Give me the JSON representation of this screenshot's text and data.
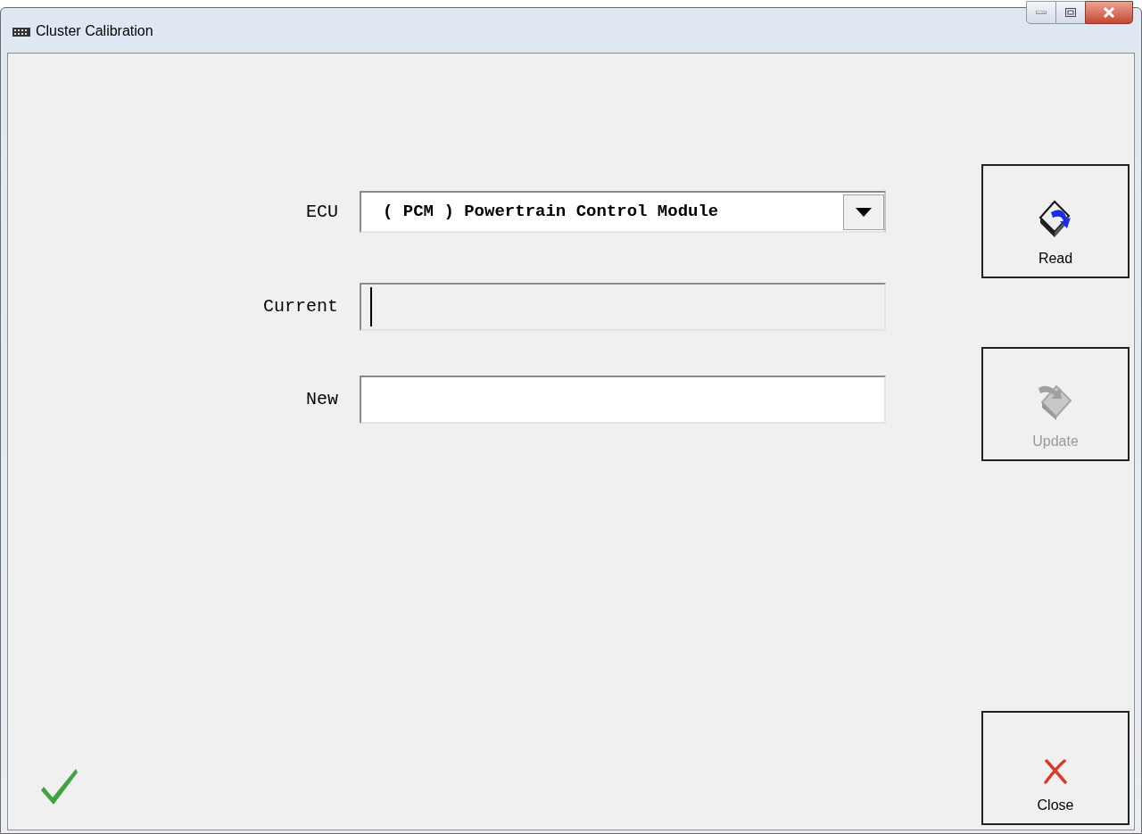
{
  "window": {
    "title": "Cluster Calibration"
  },
  "fields": [
    {
      "kind": "dropdown",
      "label": "ECU",
      "value": "( PCM ) Powertrain Control Module"
    },
    {
      "kind": "readonly",
      "label": "Current",
      "focused": true
    },
    {
      "kind": "text",
      "label": "New"
    }
  ],
  "buttons": [
    {
      "kind": "read",
      "label": "Read",
      "disabled": false
    },
    {
      "kind": "update",
      "label": "Update",
      "disabled": true
    },
    {
      "kind": "close",
      "label": "Close",
      "disabled": false
    }
  ],
  "status": {
    "kind": "ok"
  }
}
